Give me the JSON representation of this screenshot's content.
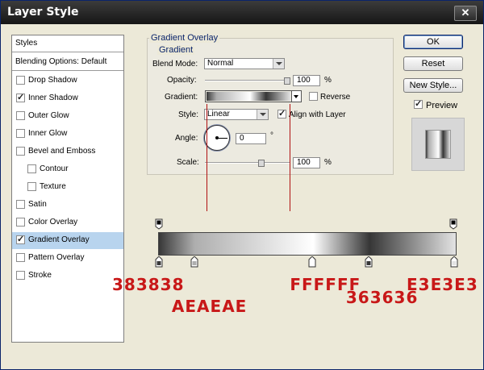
{
  "window": {
    "title": "Layer Style",
    "close_glyph": "✕"
  },
  "styles_panel": {
    "header": "Styles",
    "blending_options": "Blending Options: Default",
    "items": [
      {
        "label": "Drop Shadow",
        "checked": false,
        "indent": false,
        "selected": false
      },
      {
        "label": "Inner Shadow",
        "checked": true,
        "indent": false,
        "selected": false
      },
      {
        "label": "Outer Glow",
        "checked": false,
        "indent": false,
        "selected": false
      },
      {
        "label": "Inner Glow",
        "checked": false,
        "indent": false,
        "selected": false
      },
      {
        "label": "Bevel and Emboss",
        "checked": false,
        "indent": false,
        "selected": false
      },
      {
        "label": "Contour",
        "checked": false,
        "indent": true,
        "selected": false
      },
      {
        "label": "Texture",
        "checked": false,
        "indent": true,
        "selected": false
      },
      {
        "label": "Satin",
        "checked": false,
        "indent": false,
        "selected": false
      },
      {
        "label": "Color Overlay",
        "checked": false,
        "indent": false,
        "selected": false
      },
      {
        "label": "Gradient Overlay",
        "checked": true,
        "indent": false,
        "selected": true
      },
      {
        "label": "Pattern Overlay",
        "checked": false,
        "indent": false,
        "selected": false
      },
      {
        "label": "Stroke",
        "checked": false,
        "indent": false,
        "selected": false
      }
    ]
  },
  "gradient_overlay": {
    "group_title": "Gradient Overlay",
    "sub_title": "Gradient",
    "blend_mode_label": "Blend Mode:",
    "blend_mode_value": "Normal",
    "opacity_label": "Opacity:",
    "opacity_value": "100",
    "opacity_unit": "%",
    "opacity_fraction": 1.0,
    "gradient_label": "Gradient:",
    "reverse_label": "Reverse",
    "reverse_checked": false,
    "style_label": "Style:",
    "style_value": "Linear",
    "align_label": "Align with Layer",
    "align_checked": true,
    "angle_label": "Angle:",
    "angle_value": "0",
    "angle_unit": "°",
    "scale_label": "Scale:",
    "scale_value": "100",
    "scale_unit": "%",
    "scale_fraction": 0.67
  },
  "buttons": {
    "ok": "OK",
    "reset": "Reset",
    "new_style": "New Style...",
    "preview_label": "Preview",
    "preview_checked": true
  },
  "gradient_stops": [
    {
      "hex": "383838",
      "location": 0
    },
    {
      "hex": "AEAEAE",
      "location": 12
    },
    {
      "hex": "FFFFFF",
      "location": 52
    },
    {
      "hex": "363636",
      "location": 71
    },
    {
      "hex": "E3E3E3",
      "location": 100
    }
  ],
  "colors": {
    "annotation": "#c81818",
    "accent": "#0a246a",
    "selection": "#b8d4ee"
  }
}
